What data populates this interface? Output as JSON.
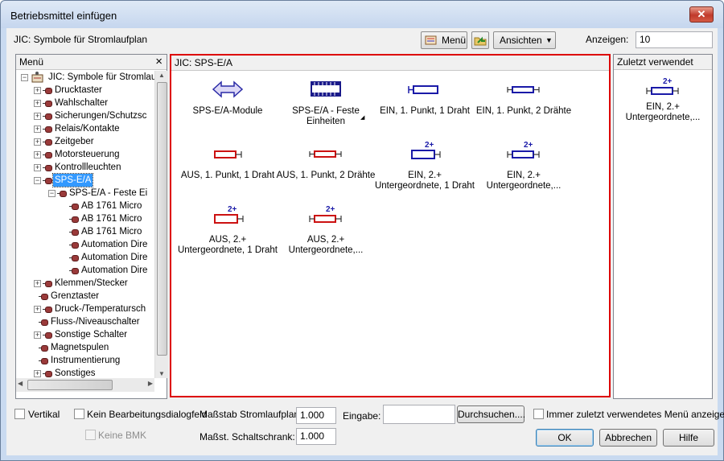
{
  "window": {
    "title": "Betriebsmittel einfügen",
    "close_glyph": "✕"
  },
  "toolbar": {
    "library_label": "JIC: Symbole für Stromlaufplan",
    "menu_button": "Menü",
    "views_button": "Ansichten",
    "show_label": "Anzeigen:",
    "show_value": "10"
  },
  "menu_panel": {
    "title": "Menü",
    "close_glyph": "×",
    "tree": [
      {
        "label": "JIC: Symbole für Stromlaufp",
        "level": 0,
        "expander": "−",
        "icon": "library-icon"
      },
      {
        "label": "Drucktaster",
        "level": 1,
        "expander": "+"
      },
      {
        "label": "Wahlschalter",
        "level": 1,
        "expander": "+"
      },
      {
        "label": "Sicherungen/Schutzsc",
        "level": 1,
        "expander": "+"
      },
      {
        "label": "Relais/Kontakte",
        "level": 1,
        "expander": "+"
      },
      {
        "label": "Zeitgeber",
        "level": 1,
        "expander": "+"
      },
      {
        "label": "Motorsteuerung",
        "level": 1,
        "expander": "+"
      },
      {
        "label": "Kontrollleuchten",
        "level": 1,
        "expander": "+"
      },
      {
        "label": "SPS-E/A",
        "level": 1,
        "expander": "−",
        "selected": true
      },
      {
        "label": "SPS-E/A - Feste Ei",
        "level": 2,
        "expander": "−"
      },
      {
        "label": "AB 1761 Micro",
        "level": 3,
        "expander": ""
      },
      {
        "label": "AB 1761 Micro",
        "level": 3,
        "expander": ""
      },
      {
        "label": "AB 1761 Micro",
        "level": 3,
        "expander": ""
      },
      {
        "label": "Automation Dire",
        "level": 3,
        "expander": ""
      },
      {
        "label": "Automation Dire",
        "level": 3,
        "expander": ""
      },
      {
        "label": "Automation Dire",
        "level": 3,
        "expander": ""
      },
      {
        "label": "Klemmen/Stecker",
        "level": 1,
        "expander": "+"
      },
      {
        "label": "Grenztaster",
        "level": 1,
        "expander": ""
      },
      {
        "label": "Druck-/Temperatursch",
        "level": 1,
        "expander": "+"
      },
      {
        "label": "Fluss-/Niveauschalter",
        "level": 1,
        "expander": ""
      },
      {
        "label": "Sonstige Schalter",
        "level": 1,
        "expander": "+"
      },
      {
        "label": "Magnetspulen",
        "level": 1,
        "expander": ""
      },
      {
        "label": "Instrumentierung",
        "level": 1,
        "expander": ""
      },
      {
        "label": "Sonstiges",
        "level": 1,
        "expander": "+"
      }
    ]
  },
  "symbols_panel": {
    "title": "JIC: SPS-E/A",
    "items": [
      {
        "line1": "SPS-E/A-Module",
        "line2": "",
        "icon": "double-arrow-icon"
      },
      {
        "line1": "SPS-E/A - Feste",
        "line2": "Einheiten",
        "icon": "plc-module-icon"
      },
      {
        "line1": "EIN, 1. Punkt, 1 Draht",
        "line2": "",
        "icon": "input-point-1wire-icon"
      },
      {
        "line1": "EIN, 1. Punkt, 2 Drähte",
        "line2": "",
        "icon": "input-point-2wire-icon"
      },
      {
        "line1": "AUS, 1. Punkt, 1 Draht",
        "line2": "",
        "icon": "output-point-1wire-icon"
      },
      {
        "line1": "AUS, 1. Punkt, 2 Drähte",
        "line2": "",
        "icon": "output-point-2wire-icon"
      },
      {
        "line1": "EIN, 2.+",
        "line2": "Untergeordnete, 1 Draht",
        "icon": "input-child-1wire-icon",
        "badge": "2+"
      },
      {
        "line1": "EIN, 2.+",
        "line2": "Untergeordnete,...",
        "icon": "input-child-2wire-icon",
        "badge": "2+"
      },
      {
        "line1": "AUS, 2.+",
        "line2": "Untergeordnete, 1 Draht",
        "icon": "output-child-1wire-icon",
        "badge": "2+"
      },
      {
        "line1": "AUS, 2.+",
        "line2": "Untergeordnete,...",
        "icon": "output-child-2wire-icon",
        "badge": "2+"
      }
    ]
  },
  "recent_panel": {
    "title": "Zuletzt verwendet",
    "item": {
      "line1": "EIN, 2.+",
      "line2": "Untergeordnete,...",
      "badge": "2+"
    }
  },
  "footer": {
    "vertical": "Vertikal",
    "no_dialog": "Kein Bearbeitungsdialogfeld",
    "no_bmk": "Keine BMK",
    "scale_schematic_label": "Maßstab Stromlaufplan:",
    "scale_schematic_value": "1.000",
    "scale_panel_label": "Maßst. Schaltschrank:",
    "scale_panel_value": "1.000",
    "input_label": "Eingabe:",
    "input_value": "",
    "browse": "Durchsuchen....",
    "always_recent": "Immer zuletzt verwendetes Menü anzeigen",
    "ok": "OK",
    "cancel": "Abbrechen",
    "help": "Hilfe"
  },
  "colors": {
    "input_blue": "#1a1aa8",
    "output_red": "#cc1111",
    "highlight_border": "#dd0000",
    "selection": "#3399ff"
  }
}
